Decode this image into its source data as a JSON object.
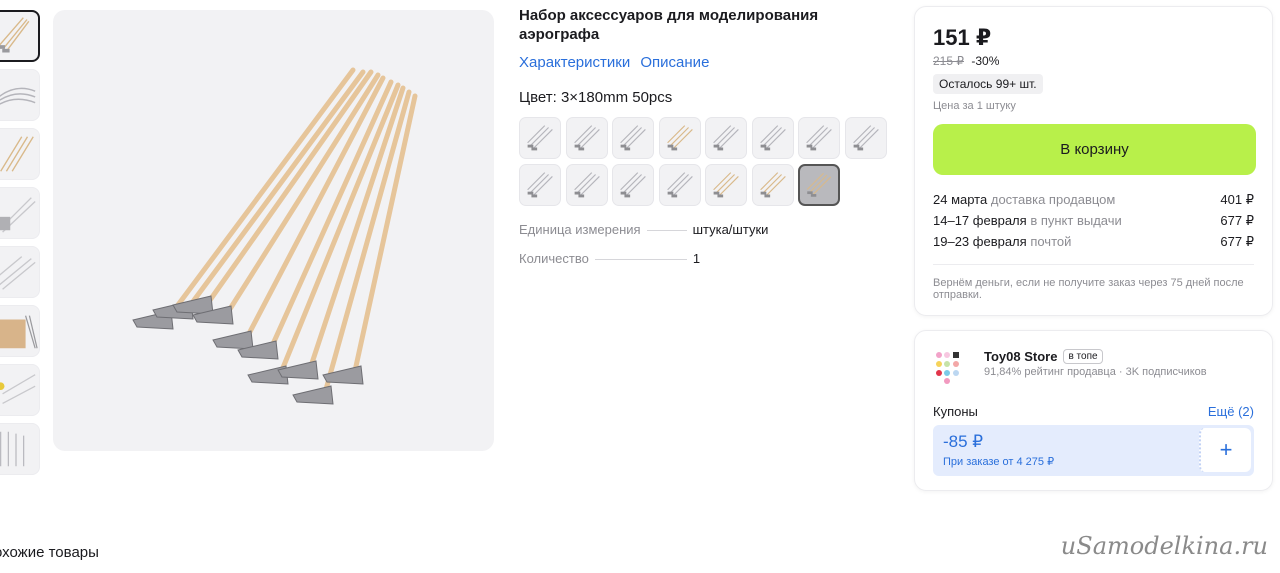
{
  "product": {
    "title": "Набор аксессуаров для моделирования аэрографа",
    "links": [
      "Характеристики",
      "Описание"
    ],
    "color_label": "Цвет: 3×180mm 50pcs",
    "swatch_count": 15,
    "selected_swatch": 14,
    "specs": [
      {
        "name": "Единица измерения",
        "value": "штука/штуки"
      },
      {
        "name": "Количество",
        "value": "1"
      }
    ]
  },
  "gallery": {
    "thumbnail_count": 8,
    "active_thumbnail": 0
  },
  "buy": {
    "price": "151 ₽",
    "old_price": "215 ₽",
    "discount": "-30%",
    "stock": "Осталось 99+ шт.",
    "unit_note": "Цена за 1 штуку",
    "cart_button": "В корзину",
    "delivery": [
      {
        "date": "24 марта",
        "method": "доставка продавцом",
        "price": "401 ₽"
      },
      {
        "date": "14–17 февраля",
        "method": "в пункт выдачи",
        "price": "677 ₽"
      },
      {
        "date": "19–23 февраля",
        "method": "почтой",
        "price": "677 ₽"
      }
    ],
    "refund_note": "Вернём деньги, если не получите заказ через 75 дней после отправки."
  },
  "store": {
    "name": "Toy08 Store",
    "badge": "в топе",
    "rating": "91,84% рейтинг продавца",
    "subscribers": "3K подписчиков",
    "coupons_label": "Купоны",
    "coupons_more": "Ещё (2)",
    "coupon_amount": "-85 ₽",
    "coupon_condition": "При заказе от 4 275 ₽",
    "coupon_add": "+"
  },
  "similar_heading": "охожие товары",
  "watermark": "uSamodelkina.ru",
  "colors": {
    "accent": "#2a6fdb",
    "cart_button": "#b8f04a",
    "coupon_bg": "#e4ecfd"
  }
}
